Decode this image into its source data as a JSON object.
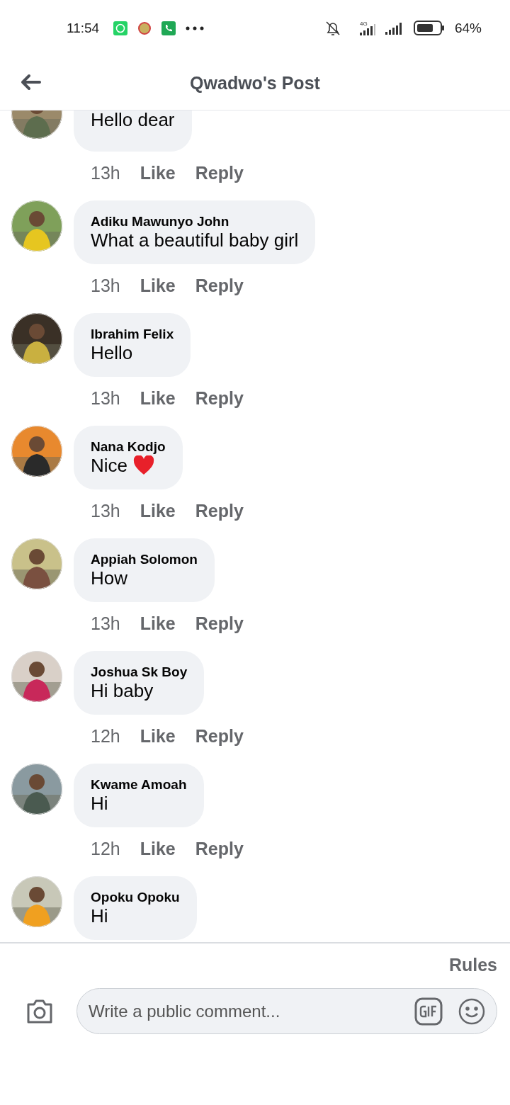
{
  "status_bar": {
    "time": "11:54",
    "network": "4G",
    "battery": "64%"
  },
  "header": {
    "title": "Qwadwo's Post"
  },
  "comments": [
    {
      "text": "Hello dear",
      "time": "13h",
      "like": "Like",
      "reply": "Reply"
    },
    {
      "author": "Adiku Mawunyo John",
      "text": "What a beautiful baby girl",
      "time": "13h",
      "like": "Like",
      "reply": "Reply"
    },
    {
      "author": "Ibrahim Felix",
      "text": "Hello",
      "time": "13h",
      "like": "Like",
      "reply": "Reply"
    },
    {
      "author": "Nana Kodjo",
      "text": "Nice",
      "heart": true,
      "time": "13h",
      "like": "Like",
      "reply": "Reply"
    },
    {
      "author": "Appiah Solomon",
      "text": "How",
      "time": "13h",
      "like": "Like",
      "reply": "Reply"
    },
    {
      "author": "Joshua Sk Boy",
      "text": "Hi baby",
      "time": "12h",
      "like": "Like",
      "reply": "Reply"
    },
    {
      "author": "Kwame Amoah",
      "text": "Hi",
      "time": "12h",
      "like": "Like",
      "reply": "Reply"
    },
    {
      "author": "Opoku Opoku",
      "text": "Hi"
    }
  ],
  "footer": {
    "rules": "Rules",
    "placeholder": "Write a public comment..."
  }
}
